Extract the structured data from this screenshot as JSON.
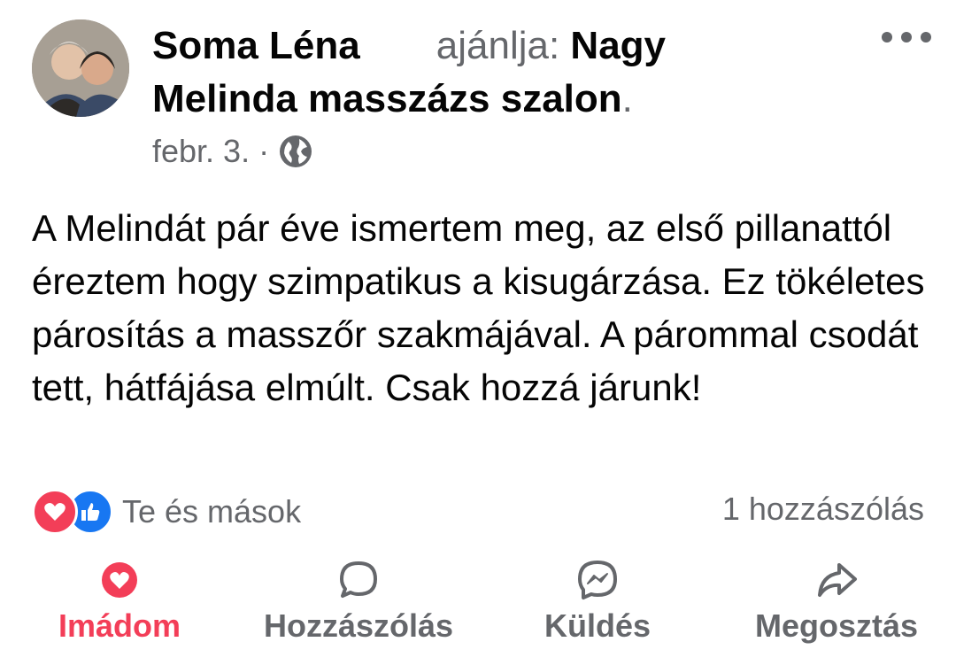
{
  "post": {
    "author": "Soma Léna",
    "recommends_prefix": "ajánlja:",
    "page_name_part1": "Nagy",
    "page_name_part2": "Melinda masszázs szalon",
    "period": ".",
    "date": "febr. 3.",
    "separator": "·",
    "privacy_icon": "globe-icon",
    "body": "A Melindát pár éve ismertem meg, az első pillanattól éreztem hogy szimpatikus a kisugárzása. Ez tökéletes párosítás a masszőr szakmájával. A párommal csodát tett, hátfájása elmúlt. Csak hozzá járunk!"
  },
  "reactions": {
    "icons": [
      "love-icon",
      "like-icon"
    ],
    "summary": "Te és mások",
    "comments": "1 hozzászólás"
  },
  "actions": {
    "love": "Imádom",
    "comment": "Hozzászólás",
    "send": "Küldés",
    "share": "Megosztás"
  },
  "colors": {
    "love_red": "#f33e58",
    "like_blue": "#1877f2",
    "muted": "#65676b",
    "text": "#050505"
  }
}
